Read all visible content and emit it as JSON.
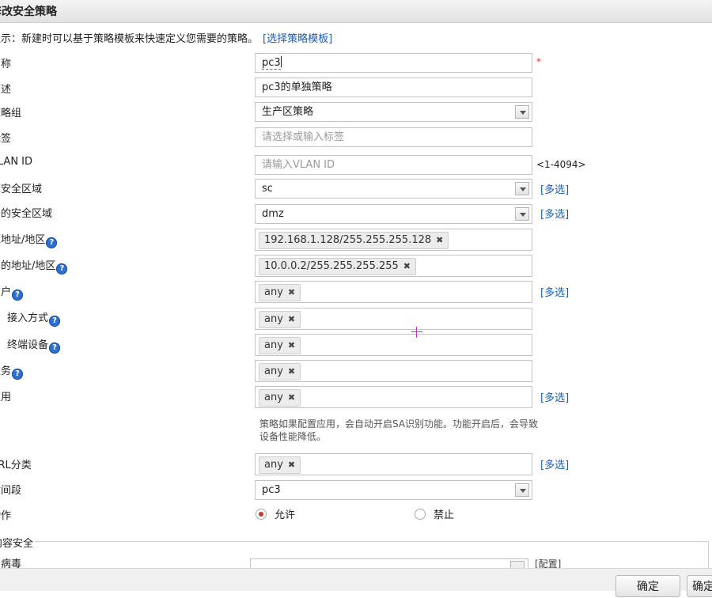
{
  "window": {
    "title": "修改安全策略"
  },
  "hint": {
    "text": "提示：新建时可以基于策略模板来快速定义您需要的策略。",
    "link": "[选择策略模板]"
  },
  "labels": {
    "name": "名称",
    "desc": "描述",
    "group": "策略组",
    "tag": "标签",
    "vlan": "VLAN ID",
    "src_zone": "源安全区域",
    "dst_zone": "目的安全区域",
    "src_addr": "源地址/地区",
    "dst_addr": "目的地址/地区",
    "user": "用户",
    "access": "接入方式",
    "terminal": "终端设备",
    "service": "服务",
    "app": "应用",
    "url": "URL分类",
    "time": "时间段",
    "action": "动作"
  },
  "fields": {
    "name": "pc3",
    "desc": "pc3的单独策略",
    "group": "生产区策略",
    "tag_placeholder": "请选择或输入标签",
    "vlan_placeholder": "请输入VLAN ID",
    "vlan_range": "<1-4094>",
    "src_zone": "sc",
    "dst_zone": "dmz",
    "time": "pc3"
  },
  "tags": {
    "src_addr": "192.168.1.128/255.255.255.128",
    "dst_addr": "10.0.0.2/255.255.255.255",
    "user": "any",
    "access": "any",
    "terminal": "any",
    "service": "any",
    "app": "any",
    "url": "any",
    "remove_glyph": "✖"
  },
  "multi_select": "[多选]",
  "required_mark": "*",
  "help_glyph": "?",
  "app_note": "策略如果配置应用，会自动开启SA识别功能。功能开启后，会导致设备性能降低。",
  "action": {
    "allow": "允许",
    "deny": "禁止",
    "selected": "allow"
  },
  "content_security": {
    "legend": "内容安全",
    "row_label": "反病毒",
    "config": "[配置]"
  },
  "buttons": {
    "ok": "确定",
    "ok2": "确定"
  },
  "colors": {
    "link": "#1a5fb4",
    "required": "#e03030",
    "help_icon": "#2f6fd0",
    "radio_selected": "#c0392b"
  }
}
